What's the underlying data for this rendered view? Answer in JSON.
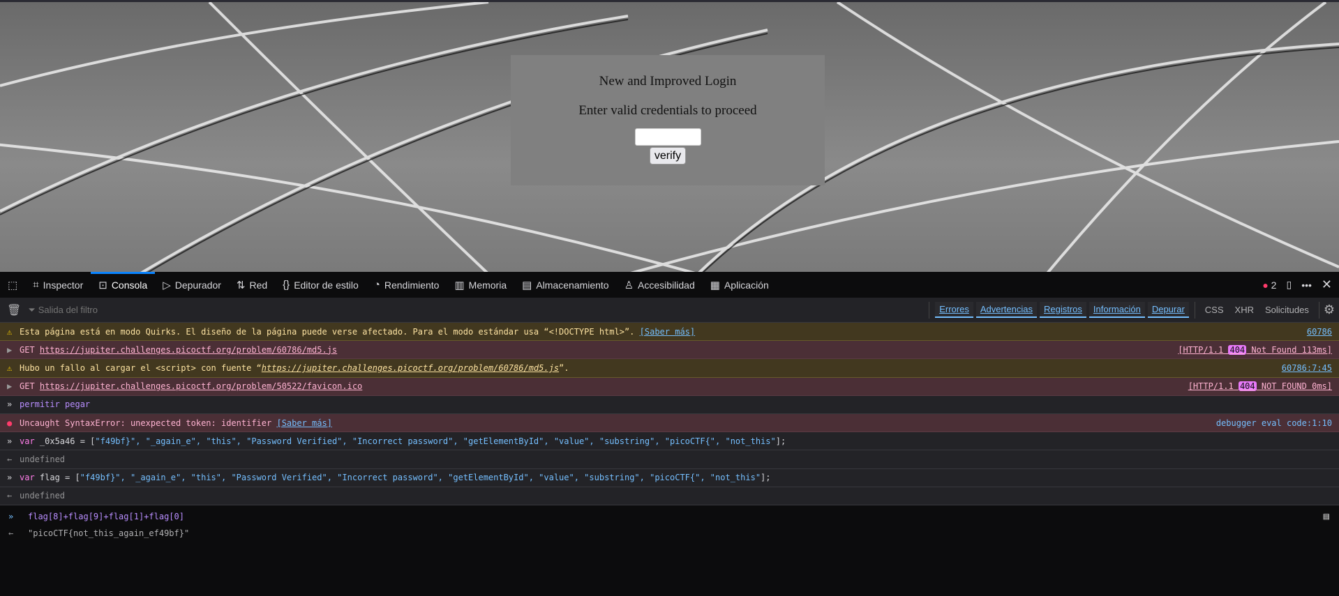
{
  "page": {
    "title": "New and Improved Login",
    "subtitle": "Enter valid credentials to proceed",
    "password_value": "",
    "verify_label": "verify"
  },
  "devtools": {
    "tabs": [
      {
        "label": "Inspector",
        "icon": "inspector-icon"
      },
      {
        "label": "Consola",
        "icon": "console-icon"
      },
      {
        "label": "Depurador",
        "icon": "debugger-icon"
      },
      {
        "label": "Red",
        "icon": "network-icon"
      },
      {
        "label": "Editor de estilo",
        "icon": "braces-icon"
      },
      {
        "label": "Rendimiento",
        "icon": "performance-icon"
      },
      {
        "label": "Memoria",
        "icon": "memory-icon"
      },
      {
        "label": "Almacenamiento",
        "icon": "storage-icon"
      },
      {
        "label": "Accesibilidad",
        "icon": "accessibility-icon"
      },
      {
        "label": "Aplicación",
        "icon": "application-icon"
      }
    ],
    "error_count": "2",
    "filter_placeholder": "Salida del filtro",
    "filters": [
      "Errores",
      "Advertencias",
      "Registros",
      "Información",
      "Depurar"
    ],
    "extra_filters": [
      "CSS",
      "XHR",
      "Solicitudes"
    ],
    "log": {
      "r1_text": "Esta página está en modo Quirks. El diseño de la página puede verse afectado. Para el modo estándar usa “<!DOCTYPE html>”. ",
      "r1_link": "[Saber más]",
      "r1_src": "60786",
      "r2_method": "GET ",
      "r2_url": "https://jupiter.challenges.picoctf.org/problem/60786/md5.js",
      "r2_pre": "[HTTP/1.1 ",
      "r2_code": "404",
      "r2_post": " Not Found 113ms]",
      "r3_text": "Hubo un fallo al cargar el <script> con fuente “",
      "r3_url": "https://jupiter.challenges.picoctf.org/problem/60786/md5.js",
      "r3_end": "”.",
      "r3_src": "60786:7:45",
      "r4_method": "GET ",
      "r4_url": "https://jupiter.challenges.picoctf.org/problem/50522/favicon.ico",
      "r4_pre": "[HTTP/1.1 ",
      "r4_code": "404",
      "r4_post": " NOT FOUND 0ms]",
      "r5_text": "permitir pegar",
      "r6_text": "Uncaught SyntaxError: unexpected token: identifier ",
      "r6_link": "[Saber más]",
      "r6_src": "debugger eval code:1:10",
      "r7_kw": "var",
      "r7_name": " _0x5a46 = [",
      "r7_vals": "\"f49bf}\", \"_again_e\", \"this\", \"Password Verified\", \"Incorrect password\", \"getElementById\", \"value\", \"substring\", \"picoCTF{\", \"not_this\"",
      "r7_end": "];",
      "r8_text": "undefined",
      "r9_kw": "var",
      "r9_name": " flag = [",
      "r9_vals": "\"f49bf}\", \"_again_e\", \"this\", \"Password Verified\", \"Incorrect password\", \"getElementById\", \"value\", \"substring\", \"picoCTF{\", \"not_this\"",
      "r9_end": "];",
      "r10_text": "undefined"
    },
    "input_value": "flag[8]+flag[9]+flag[1]+flag[0]",
    "input_result": "\"picoCTF{not_this_again_ef49bf}\""
  }
}
